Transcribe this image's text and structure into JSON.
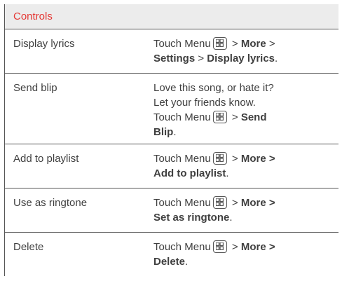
{
  "header": "Controls",
  "rows": [
    {
      "name": "Display lyrics",
      "line1": {
        "prefix": "Touch Menu",
        "sep1": " > ",
        "b1": "More",
        "sep2": " >"
      },
      "line2": {
        "b1": "Settings",
        "sep": " > ",
        "b2": "Display lyrics",
        "end": "."
      }
    },
    {
      "name": "Send blip",
      "line1": "Love this song, or hate it?",
      "line2": "Let your friends know.",
      "line3": {
        "prefix": "Touch Menu",
        "sep": " > ",
        "b1": "Send"
      },
      "line4": {
        "b1": "Blip",
        "end": "."
      }
    },
    {
      "name": "Add to playlist",
      "line1": {
        "prefix": "Touch Menu",
        "sep": " > ",
        "b1": "More >"
      },
      "line2": {
        "b1": "Add to playlist",
        "end": "."
      }
    },
    {
      "name": "Use as ringtone",
      "line1": {
        "prefix": "Touch Menu",
        "sep": " > ",
        "b1": "More >"
      },
      "line2": {
        "b1": "Set as ringtone",
        "end": "."
      }
    },
    {
      "name": "Delete",
      "line1": {
        "prefix": "Touch Menu",
        "sep": " > ",
        "b1": "More >"
      },
      "line2": {
        "b1": "Delete",
        "end": "."
      }
    }
  ],
  "icons": {
    "menu": "menu-grid-icon"
  }
}
